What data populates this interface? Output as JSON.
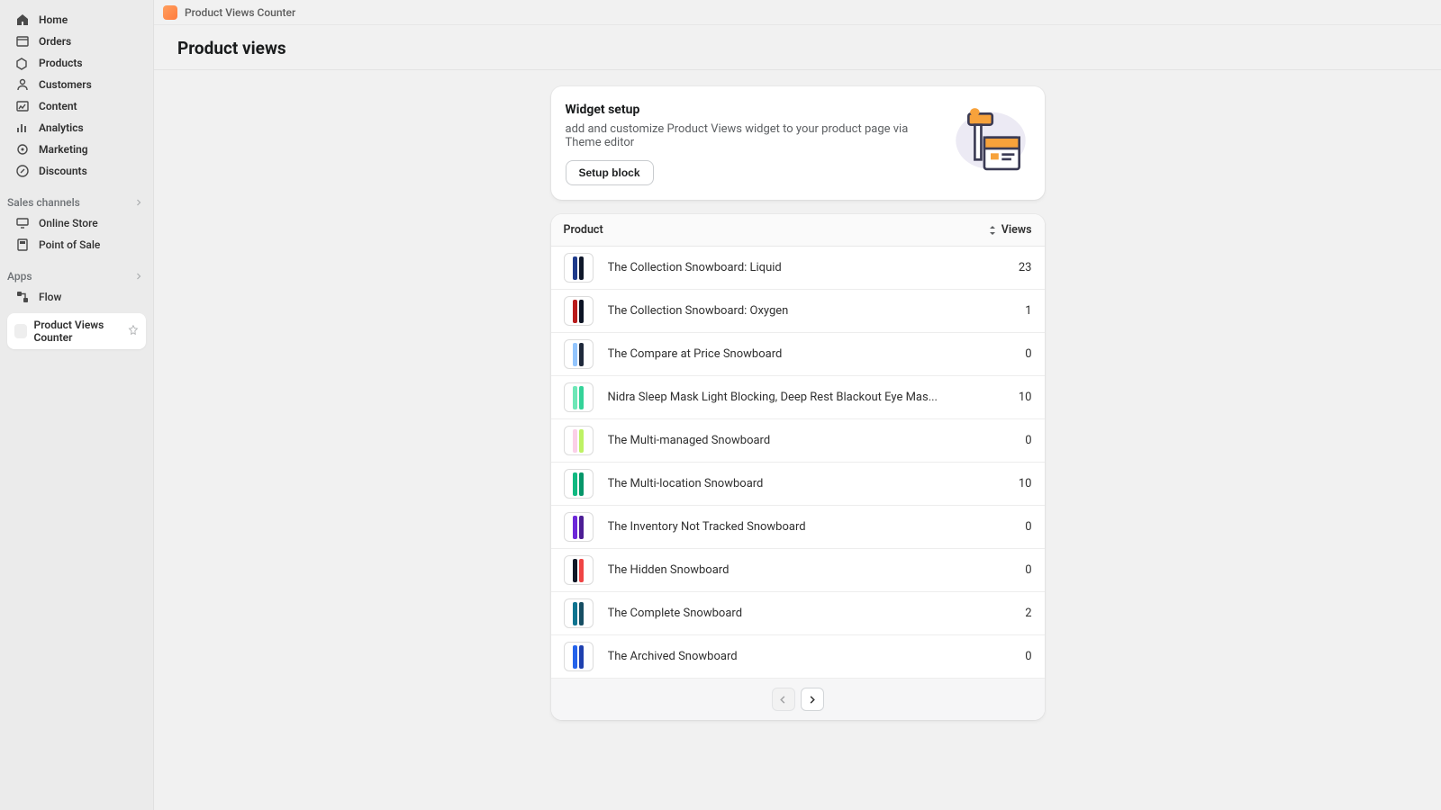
{
  "sidebar": {
    "items": [
      {
        "label": "Home",
        "icon": "home"
      },
      {
        "label": "Orders",
        "icon": "orders"
      },
      {
        "label": "Products",
        "icon": "products"
      },
      {
        "label": "Customers",
        "icon": "customers"
      },
      {
        "label": "Content",
        "icon": "content"
      },
      {
        "label": "Analytics",
        "icon": "analytics"
      },
      {
        "label": "Marketing",
        "icon": "marketing"
      },
      {
        "label": "Discounts",
        "icon": "discounts"
      }
    ],
    "sales_channels_label": "Sales channels",
    "sales_channels": [
      {
        "label": "Online Store",
        "icon": "onlinestore"
      },
      {
        "label": "Point of Sale",
        "icon": "pos"
      }
    ],
    "apps_label": "Apps",
    "apps": [
      {
        "label": "Flow",
        "icon": "flow"
      }
    ],
    "current_app": "Product Views Counter"
  },
  "topbar": {
    "app_name": "Product Views Counter"
  },
  "page": {
    "title": "Product views"
  },
  "widget": {
    "title": "Widget setup",
    "subtitle": "add and customize Product Views widget to your product page via Theme editor",
    "button": "Setup block"
  },
  "table": {
    "col_product": "Product",
    "col_views": "Views",
    "rows": [
      {
        "name": "The Collection Snowboard: Liquid",
        "views": "23",
        "c1": "#1e3a8a",
        "c2": "#0f172a"
      },
      {
        "name": "The Collection Snowboard: Oxygen",
        "views": "1",
        "c1": "#b91c1c",
        "c2": "#0b1324"
      },
      {
        "name": "The Compare at Price Snowboard",
        "views": "0",
        "c1": "#93c5fd",
        "c2": "#1e293b"
      },
      {
        "name": "Nidra Sleep Mask Light Blocking, Deep Rest Blackout Eye Mas...",
        "views": "10",
        "c1": "#6ee7b7",
        "c2": "#34d399"
      },
      {
        "name": "The Multi-managed Snowboard",
        "views": "0",
        "c1": "#fbcfe8",
        "c2": "#bef264"
      },
      {
        "name": "The Multi-location Snowboard",
        "views": "10",
        "c1": "#10b981",
        "c2": "#059669"
      },
      {
        "name": "The Inventory Not Tracked Snowboard",
        "views": "0",
        "c1": "#6d28d9",
        "c2": "#4c1d95"
      },
      {
        "name": "The Hidden Snowboard",
        "views": "0",
        "c1": "#111827",
        "c2": "#ef4444"
      },
      {
        "name": "The Complete Snowboard",
        "views": "2",
        "c1": "#0e7490",
        "c2": "#164e63"
      },
      {
        "name": "The Archived Snowboard",
        "views": "0",
        "c1": "#2563eb",
        "c2": "#1e40af"
      }
    ]
  }
}
